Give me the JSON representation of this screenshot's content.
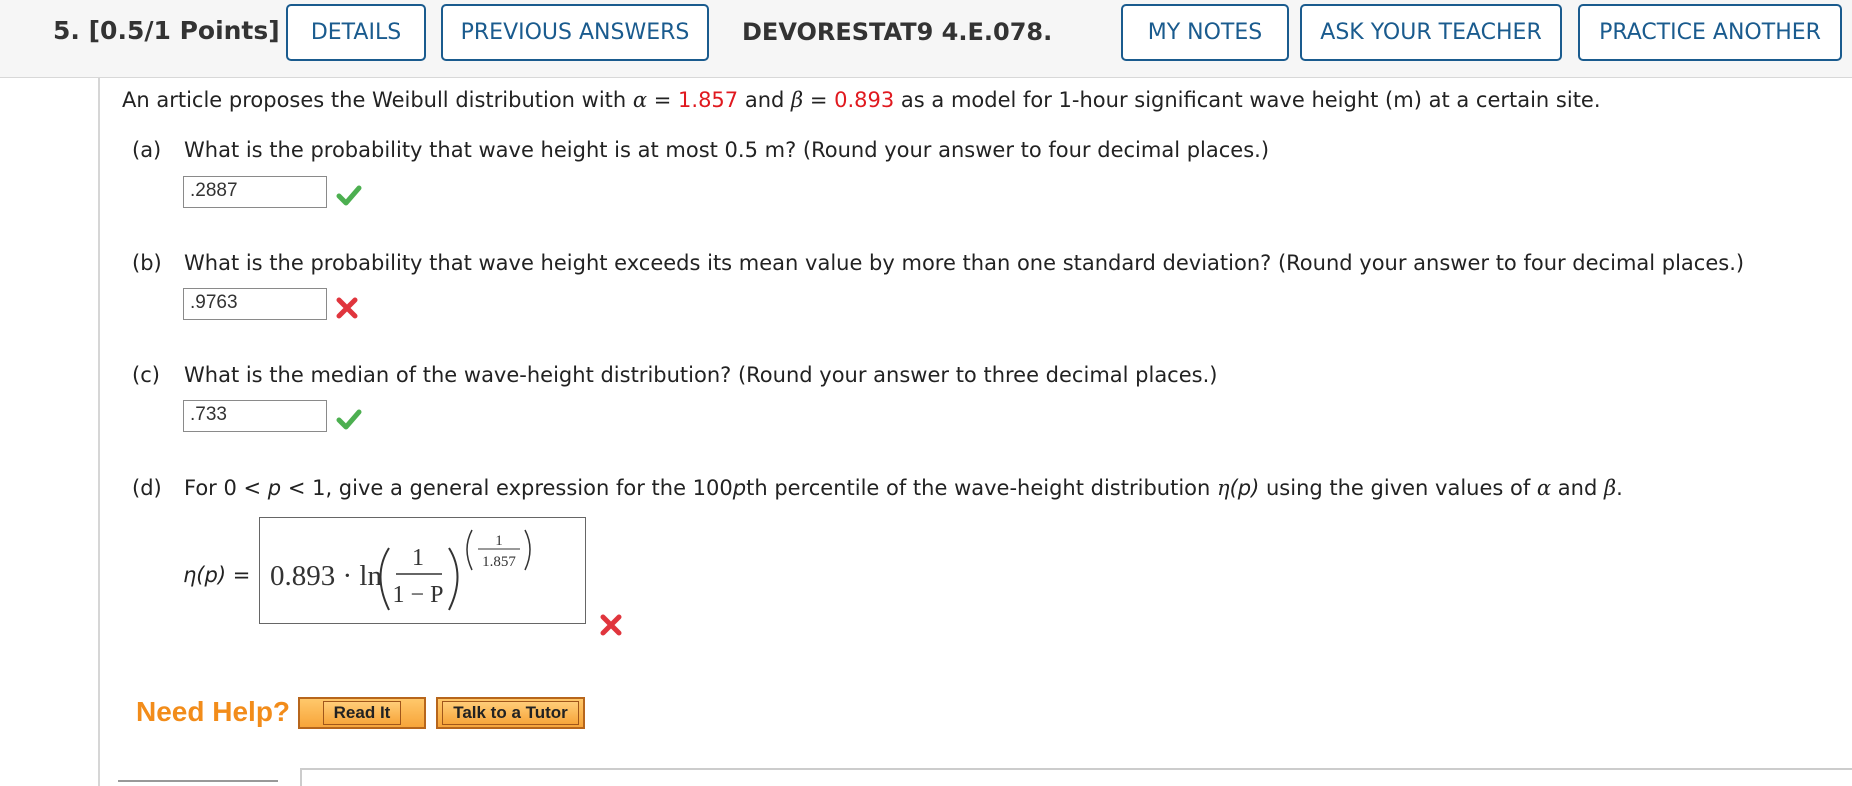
{
  "header": {
    "question_number": "5.",
    "points": "[0.5/1 Points]",
    "details_label": "DETAILS",
    "previous_answers_label": "PREVIOUS ANSWERS",
    "question_id": "DEVORESTAT9 4.E.078.",
    "my_notes_label": "MY NOTES",
    "ask_teacher_label": "ASK YOUR TEACHER",
    "practice_another_label": "PRACTICE ANOTHER"
  },
  "intro": {
    "text_1": "An article proposes the Weibull distribution with ",
    "alpha_sym": "α",
    "eq": " = ",
    "alpha_value": "1.857",
    "and": " and ",
    "beta_sym": "β",
    "beta_value": "0.893",
    "text_2": " as a model for 1-hour significant wave height (m) at a certain site."
  },
  "parts": {
    "a": {
      "label": "(a)",
      "question": "What is the probability that wave height is at most 0.5 m? (Round your answer to four decimal places.)",
      "answer": ".2887",
      "status": "correct"
    },
    "b": {
      "label": "(b)",
      "question": "What is the probability that wave height exceeds its mean value by more than one standard deviation? (Round your answer to four decimal places.)",
      "answer": ".9763",
      "status": "incorrect"
    },
    "c": {
      "label": "(c)",
      "question": "What is the median of the wave-height distribution? (Round your answer to three decimal places.)",
      "answer": ".733",
      "status": "correct"
    },
    "d": {
      "label": "(d)",
      "q_pre": "For 0 < ",
      "p": "p",
      "q_mid": " < 1, give a general expression for the 100",
      "q_mid2": "th percentile of the wave-height distribution ",
      "eta": "η",
      "paren_p": "(p)",
      "q_post": " using the given values of ",
      "alpha": "α",
      "and": " and ",
      "beta": "β",
      "period": ".",
      "eta_label": "η(p) =",
      "math": {
        "coef": "0.893 · ln",
        "num": "1",
        "den": "1 − P",
        "exp_num": "1",
        "exp_den": "1.857"
      },
      "status": "incorrect"
    }
  },
  "help": {
    "label": "Need Help?",
    "read_it": "Read It",
    "talk_tutor": "Talk to a Tutor"
  },
  "colors": {
    "link_blue": "#1a5b8e",
    "highlight_red": "#e0191f",
    "check_green": "#4caf50",
    "cross_red": "#e0353d",
    "help_orange": "#f28c1a"
  }
}
